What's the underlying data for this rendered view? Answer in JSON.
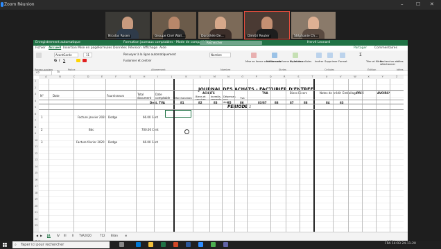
{
  "zoom": {
    "title": "Zoom Réunion",
    "window_controls": [
      "–",
      "☐",
      "✕"
    ]
  },
  "participants": [
    {
      "name": "Nicolas Rosen"
    },
    {
      "name": "Groupe Ciné Wall..."
    },
    {
      "name": "Dorothée De..."
    },
    {
      "name": "Dimitri Reuter"
    },
    {
      "name": "Stéphanie Ch..."
    }
  ],
  "excel": {
    "titlebar": {
      "autosave": "Enregistrement automatique",
      "filename": "Formation journaux comptables - Mode de compatibilité",
      "search_placeholder": "Rechercher",
      "user": "Hervé Leonard"
    },
    "menu": [
      "Fichier",
      "Accueil",
      "Insertion",
      "Mise en page",
      "Formules",
      "Données",
      "Révision",
      "Affichage",
      "Aide"
    ],
    "share": "Partager",
    "comments": "Commentaires",
    "ribbon": {
      "font_name": "AvantGarde",
      "font_size": "11",
      "number_format": "Nombre",
      "groups": [
        "Presse-papiers",
        "Police",
        "Alignement",
        "Nombre",
        "Styles",
        "Cellules",
        "Édition",
        "Idées"
      ],
      "wrap": "Renvoyer à la ligne automatiquement",
      "merge": "Fusionner et centrer",
      "cond_format": "Mise en forme conditionnelle",
      "table_format": "Mettre sous forme de tableau",
      "cell_styles": "Styles de cellules",
      "insert": "Insérer",
      "delete": "Supprimer",
      "format": "Format",
      "sort": "Trier et filtrer",
      "find": "Rechercher et sélectionner",
      "ideas": "Idées"
    },
    "namebox": "G2",
    "columns": [
      "A",
      "B",
      "C",
      "D",
      "E",
      "F",
      "G",
      "H",
      "I",
      "J",
      "K",
      "L",
      "M",
      "N",
      "O",
      "P",
      "Q",
      "R",
      "S",
      "T",
      "U",
      "V",
      "W",
      "X",
      "Y",
      "Z"
    ],
    "rows": [
      "1",
      "2",
      "3",
      "4",
      "5",
      "6",
      "7",
      "8",
      "9",
      "10",
      "11",
      "12",
      "13",
      "14",
      "15",
      "16",
      "17",
      "18",
      "19",
      "20",
      "21",
      "22",
      "23"
    ],
    "sheet": {
      "journal_title": "JOURNAL DES ACHATS - FACTURIER D'ENTREE",
      "period": "PERIODE :",
      "col_headers": [
        "N°",
        "Date",
        "Fournisseurs",
        "Total document",
        "Date comptable"
      ],
      "groups": [
        "ACHATS",
        "TVA",
        "Biens Divers",
        "Notes de crédit",
        "Emballage",
        "PRIX",
        "AVOIRS*"
      ],
      "sub_headers": [
        "Marchandises",
        "Biens et services",
        "Investis-sements",
        "Dépenses non ded.",
        "Tva"
      ],
      "codes": [
        "81",
        "82",
        "83",
        "85",
        "86",
        "83/87",
        "88",
        "87",
        "88",
        "84",
        "63"
      ],
      "dest_label": "Dest. TVA",
      "entries": [
        {
          "n": "1",
          "desc": "Facture janvier 2020",
          "supplier": "Dodge",
          "amount": "66.00 Cent"
        },
        {
          "n": "2",
          "desc": "Bdc",
          "supplier": "",
          "amount": "700.00 Cent"
        },
        {
          "n": "3",
          "desc": "Facture février 2020",
          "supplier": "Dodge",
          "amount": "66.00 Cent"
        }
      ]
    },
    "tabs": [
      "JA",
      "IV",
      "III",
      "II",
      "TVA2020",
      "T12",
      "Bilan"
    ],
    "status": {
      "left": "Prêt",
      "zoom": "100%"
    }
  },
  "taskbar": {
    "search_placeholder": "Taper ici pour rechercher",
    "lang": "FRA",
    "time": "14:03",
    "date": "24-11-20"
  }
}
